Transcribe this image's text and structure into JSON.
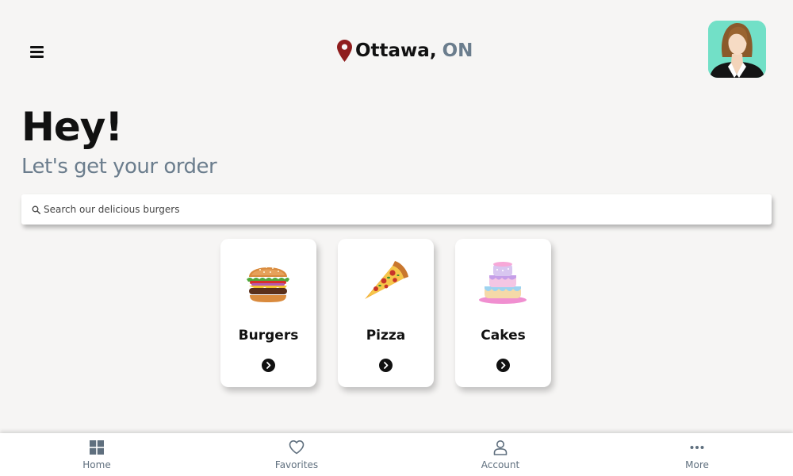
{
  "header": {
    "city": "Ottawa,",
    "province": "ON",
    "menu_icon": "hamburger-menu-icon",
    "location_icon": "map-pin-icon",
    "avatar_icon": "user-avatar"
  },
  "greeting": {
    "title": "Hey!",
    "subtitle": "Let's get your order"
  },
  "search": {
    "placeholder": "Search our delicious burgers",
    "icon": "search-icon"
  },
  "categories": [
    {
      "label": "Burgers",
      "icon": "burger-image"
    },
    {
      "label": "Pizza",
      "icon": "pizza-image"
    },
    {
      "label": "Cakes",
      "icon": "cake-image"
    }
  ],
  "nav": {
    "items": [
      {
        "label": "Home",
        "icon": "home-grid-icon"
      },
      {
        "label": "Favorites",
        "icon": "heart-icon"
      },
      {
        "label": "Account",
        "icon": "account-icon"
      },
      {
        "label": "More",
        "icon": "more-dots-icon"
      }
    ]
  },
  "colors": {
    "background": "#f6f5f4",
    "accent_text": "#6b7d8d",
    "pin": "#8f1d1d",
    "avatar_bg": "#72e0c7",
    "nav_text": "#5f6f7e"
  }
}
